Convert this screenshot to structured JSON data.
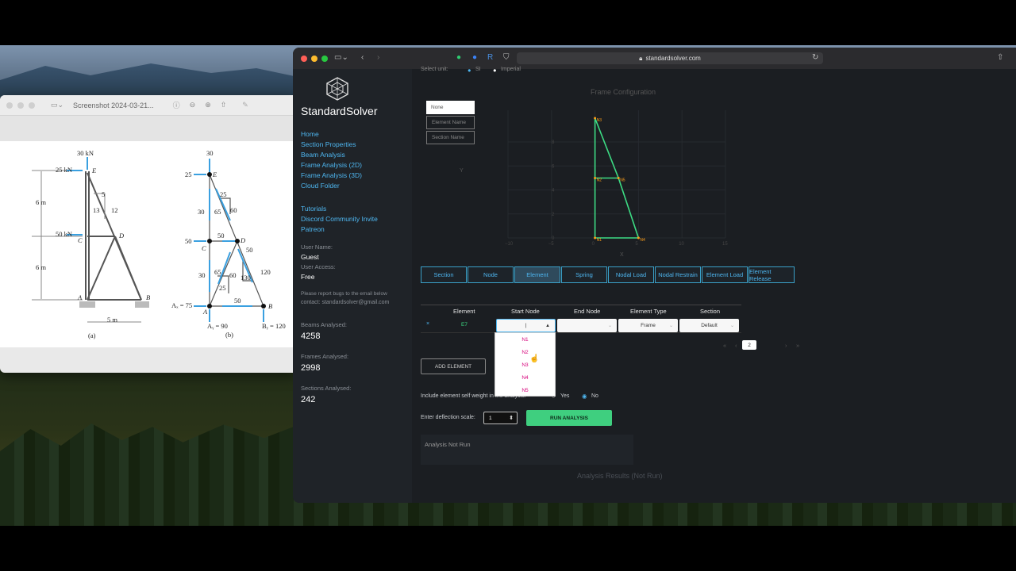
{
  "preview": {
    "window_title": "Screenshot 2024-03-21...",
    "figure_a": {
      "top_load": "30 kN",
      "left_load_e": "25 kN",
      "left_load_c": "50 kN",
      "node_e": "E",
      "node_c": "C",
      "node_d": "D",
      "node_a": "A",
      "node_b": "B",
      "dim_top": "6 m",
      "dim_bottom": "6 m",
      "slope_5": "5",
      "slope_13": "13",
      "slope_12": "12",
      "span": "5 m",
      "caption": "(a)"
    },
    "figure_b": {
      "top": "30",
      "e_left": "25",
      "c_left": "50",
      "m30a": "30",
      "m25a": "25",
      "m65a": "65",
      "m60a": "60",
      "m50": "50",
      "m30b": "30",
      "m65b": "65",
      "m60b": "60",
      "m25b": "25",
      "m50b": "50",
      "m130": "130",
      "m120": "120",
      "m50c": "50",
      "ax": "Aₓ = 75",
      "ay": "Aᵧ = 90",
      "by": "Bᵧ = 120",
      "node_e": "E",
      "node_c": "C",
      "node_d": "D",
      "node_a": "A",
      "node_b": "B",
      "caption": "(b)"
    }
  },
  "browser": {
    "url": "standardsolver.com"
  },
  "sidebar": {
    "brand": "StandardSolver",
    "nav": [
      "Home",
      "Section Properties",
      "Beam Analysis",
      "Frame Analysis (2D)",
      "Frame Analysis (3D)",
      "Cloud Folder"
    ],
    "community": [
      "Tutorials",
      "Discord Community Invite",
      "Patreon"
    ],
    "user_name_label": "User Name:",
    "user_name": "Guest",
    "user_access_label": "User Access:",
    "user_access": "Free",
    "report_line1": "Please report bugs to the email below",
    "report_line2": "contact: standardsolver@gmail.com",
    "beams_label": "Beams Analysed:",
    "beams": "4258",
    "frames_label": "Frames Analysed:",
    "frames": "2998",
    "sections_label": "Sections Analysed:",
    "sections": "242"
  },
  "main": {
    "unit_label": "Select unit:",
    "unit_si": "SI",
    "unit_imperial": "Imperial",
    "chart_title": "Frame Configuration",
    "display_options": [
      "None",
      "Element Name",
      "Section Name"
    ],
    "axis_x_label": "X",
    "axis_y_label": "Y",
    "x_ticks": [
      "−10",
      "−5",
      "0",
      "5",
      "10",
      "15"
    ],
    "y_ticks": [
      "0",
      "2",
      "4",
      "6",
      "8"
    ],
    "node_labels": [
      "N1",
      "N2",
      "N3",
      "N4",
      "N5"
    ],
    "tabs": [
      "Section",
      "Node",
      "Element",
      "Spring",
      "Nodal Load",
      "Nodal Restrain",
      "Element Load",
      "Element Release"
    ],
    "active_tab": "Element",
    "table": {
      "headers": [
        "Element",
        "Start Node",
        "End Node",
        "Element Type",
        "Section"
      ],
      "row": {
        "remove": "×",
        "element": "E7",
        "start": "|",
        "end": "",
        "type": "Frame",
        "section": "Default"
      }
    },
    "start_node_options": [
      "N1",
      "N2",
      "N3",
      "N4",
      "N5"
    ],
    "pagination": {
      "current": "2",
      "first": "«",
      "prev": "‹",
      "next": "›",
      "last": "»"
    },
    "add_element": "ADD ELEMENT",
    "self_weight_label": "Include element self weight in the analysis:",
    "self_weight_yes": "Yes",
    "self_weight_no": "No",
    "deflection_label": "Enter deflection scale:",
    "deflection_value": "1",
    "run_analysis": "RUN ANALYSIS",
    "analysis_status": "Analysis Not Run",
    "results_title": "Analysis Results (Not Run)",
    "colors": {
      "accent": "#4eb6f0",
      "frame": "#3ddc84",
      "node": "#ff9f1a",
      "run": "#3fcf7f"
    }
  }
}
